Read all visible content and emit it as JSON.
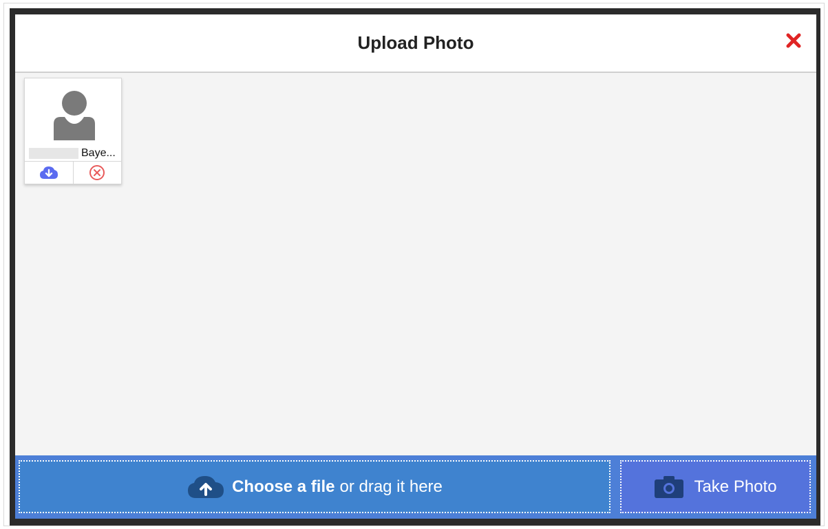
{
  "modal": {
    "title": "Upload Photo",
    "close_icon": "close-x-icon",
    "close_color": "#e02424"
  },
  "photo_card": {
    "name": "Baye...",
    "avatar_icon": "person-silhouette-icon",
    "download_icon": "cloud-download-icon",
    "remove_icon": "circle-x-icon",
    "download_color": "#5b6bf0",
    "remove_color": "#e85a5a"
  },
  "upload_bar": {
    "choose_bold": "Choose a file",
    "choose_rest": "or drag it here",
    "choose_icon": "cloud-upload-icon",
    "take_photo_label": "Take Photo",
    "take_photo_icon": "camera-icon",
    "choose_bg": "#3f83cf",
    "take_bg": "#5473dc"
  }
}
